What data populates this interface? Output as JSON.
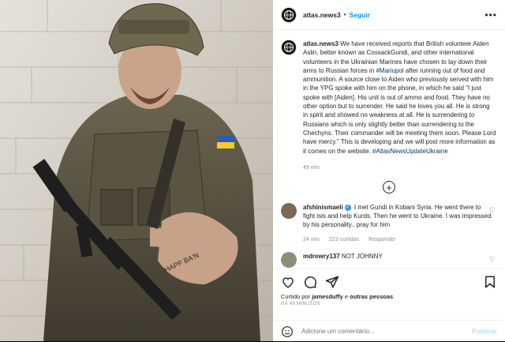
{
  "post": {
    "username": "atlas.news3",
    "separator": "•",
    "follow_label": "Seguir",
    "more_icon": "more-icon"
  },
  "caption": {
    "username": "atlas.news3",
    "text_1": "We have received reports that British volunteer Aiden Aslin, better known as CossackGundi, and other international volunteers in the Ukrainian Marines have chosen to lay down their arms to Russian forces in ",
    "tag_1": "#Mariupol",
    "text_2": " after running out of food and ammunition. A source close to Aiden who previously served with him in the YPG spoke with him on the phone, in which he said \"I just spoke with [Aiden]. His unit is out of ammo and food. They have no other option but to surrender. He said he loves you all. He is strong in spirit and showed no weakness at all. He is surrendering to Russians which is only slightly better than surrendering to the Chechyns. Their commander will be meeting them soon. Please Lord have mercy.\" This is developing and we will post more information as it comes on the website. ",
    "tag_2": "#AtlasNewsUpdateUkraine",
    "time": "49 min"
  },
  "comments": [
    {
      "username": "afshinismaeli",
      "text": " I met Gundi in Kobani Syria. He went there to fight isis and help Kurds. Then he went to Ukraine. I was impressed by his personality.. pray for him",
      "time": "24 min",
      "likes": "223 curtidas",
      "reply": "Responder"
    },
    {
      "username": "mdrewry137",
      "text": " NOT JOHNNY"
    }
  ],
  "actions": {
    "liked_prefix": "Curtido por ",
    "liked_user": "jamesduffy",
    "liked_suffix": " e ",
    "liked_others": "outras pessoas",
    "ago": "HÁ 49 MINUTOS"
  },
  "add_comment": {
    "placeholder": "Adicione um comentário...",
    "publish_label": "Publicar"
  },
  "colors": {
    "link": "#0095f6",
    "hashtag": "#00376b",
    "muted": "#8e8e8e",
    "publish_disabled": "#b2dffc"
  }
}
